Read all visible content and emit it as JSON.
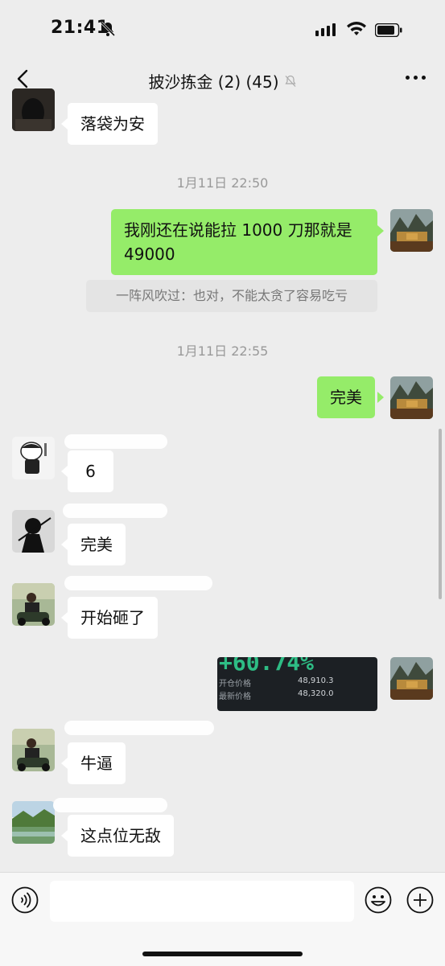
{
  "status_bar": {
    "time": "21:41"
  },
  "nav": {
    "title": "披沙拣金 (2) (45)"
  },
  "messages": {
    "m1": "落袋为安",
    "ts1": "1月11日 22:50",
    "m2_line1": "我刚还在说能拉 1000 刀那就是",
    "m2_line2": "49000",
    "quote": "一阵风吹过：也对，不能太贪了容易吃亏",
    "ts2": "1月11日 22:55",
    "m3": "完美",
    "m4": "6",
    "m5": "完美",
    "m6": "开始砸了",
    "m7": "牛逼",
    "m8": "这点位无敌"
  },
  "trade_image": {
    "percent": "+60.74%",
    "open_label": "开仓价格",
    "open_value": "48,910.3",
    "last_label": "最新价格",
    "last_value": "48,320.0"
  },
  "colors": {
    "outgoing_bubble": "#95ec69",
    "incoming_bubble": "#ffffff",
    "background": "#ededed"
  }
}
